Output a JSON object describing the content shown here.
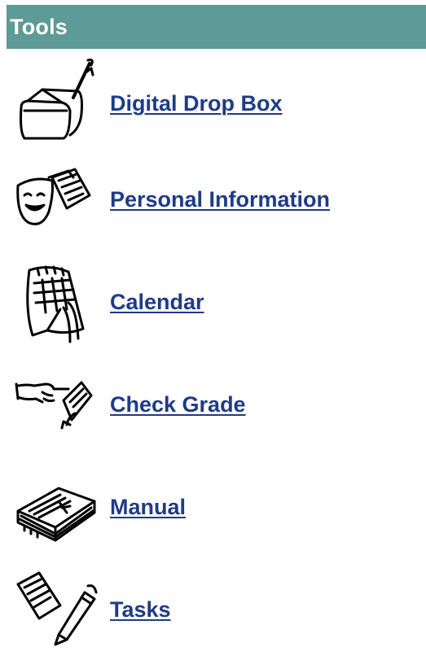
{
  "header": {
    "title": "Tools"
  },
  "colors": {
    "header_bg": "#5e9a97",
    "header_text": "#ffffff",
    "link": "#1f3b86"
  },
  "tools": [
    {
      "label": "Digital Drop Box",
      "icon": "drop-box-icon"
    },
    {
      "label": "Personal Information",
      "icon": "masks-document-icon"
    },
    {
      "label": "Calendar",
      "icon": "calendar-icon"
    },
    {
      "label": "Check Grade",
      "icon": "pointing-hand-document-icon"
    },
    {
      "label": "Manual",
      "icon": "book-icon"
    },
    {
      "label": "Tasks",
      "icon": "pencil-paper-icon"
    }
  ]
}
